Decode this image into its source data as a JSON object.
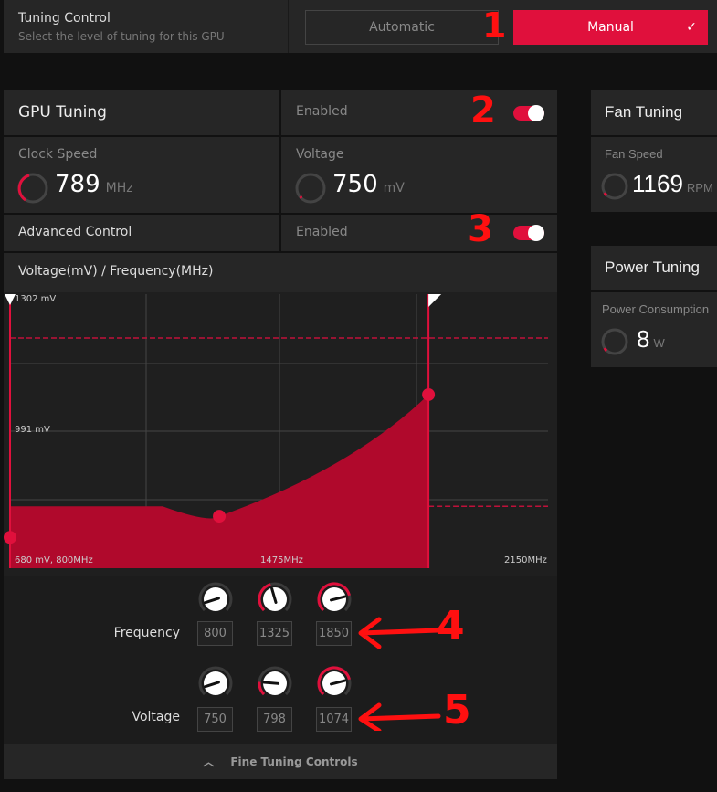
{
  "tuning_control": {
    "title": "Tuning Control",
    "subtitle": "Select the level of tuning for this GPU",
    "options": [
      "Automatic",
      "Manual"
    ],
    "selected": "Manual"
  },
  "gpu_tuning": {
    "title": "GPU Tuning",
    "status": "Enabled",
    "enabled": true,
    "clock_speed": {
      "label": "Clock Speed",
      "value": "789",
      "unit": "MHz"
    },
    "voltage": {
      "label": "Voltage",
      "value": "750",
      "unit": "mV"
    },
    "advanced_control": {
      "label": "Advanced Control",
      "status": "Enabled",
      "enabled": true
    },
    "chart_title": "Voltage(mV) / Frequency(MHz)"
  },
  "fan_tuning": {
    "title": "Fan Tuning",
    "fan_speed": {
      "label": "Fan Speed",
      "value": "1169",
      "unit": "RPM"
    }
  },
  "power_tuning": {
    "title": "Power Tuning",
    "consumption": {
      "label": "Power Consumption",
      "value": "8",
      "unit": "W"
    }
  },
  "chart_data": {
    "type": "area",
    "xlabel": "",
    "ylabel": "",
    "y_tick_labels": [
      "1302 mV",
      "991 mV"
    ],
    "x_tick_labels": [
      "680 mV, 800MHz",
      "1475MHz",
      "2150MHz"
    ],
    "xlim": [
      800,
      2150
    ],
    "ylim": [
      680,
      1302
    ],
    "points": [
      {
        "x": 800,
        "y": 750
      },
      {
        "x": 1325,
        "y": 798
      },
      {
        "x": 1850,
        "y": 1074
      }
    ],
    "grid": true,
    "accent": "#e0103c"
  },
  "fine_tuning": {
    "frequency": {
      "label": "Frequency",
      "values": [
        "800",
        "1325",
        "1850"
      ],
      "levels": [
        0,
        0.4,
        0.8
      ]
    },
    "voltage": {
      "label": "Voltage",
      "values": [
        "750",
        "798",
        "1074"
      ],
      "levels": [
        0,
        0.1,
        0.8
      ]
    },
    "toggle_label": "Fine Tuning Controls"
  },
  "annotations": [
    "1",
    "2",
    "3",
    "4",
    "5"
  ]
}
